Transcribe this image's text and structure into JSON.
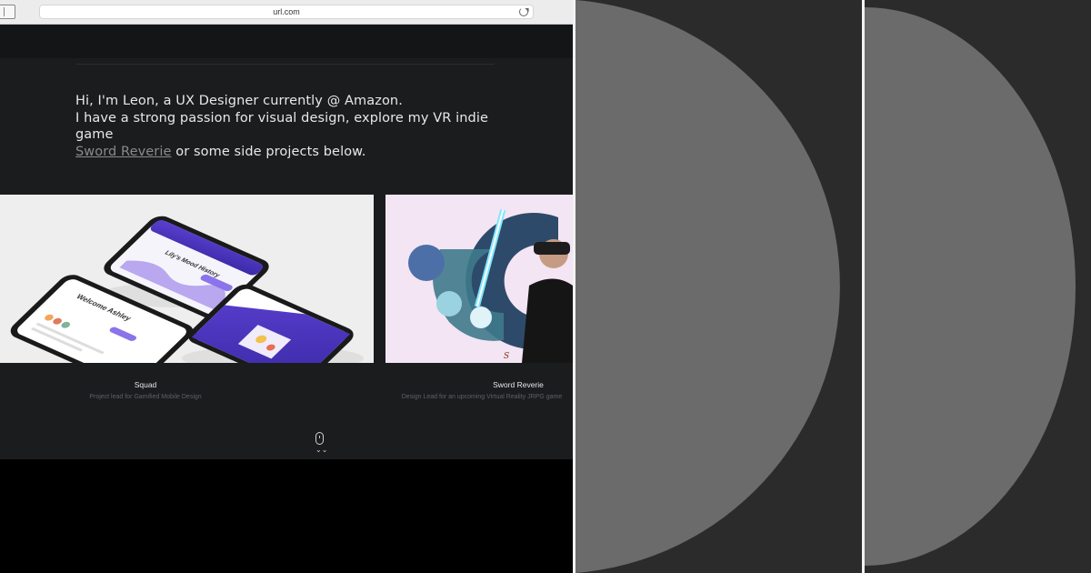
{
  "browser": {
    "url": "url.com"
  },
  "intro": {
    "line1": "Hi, I'm Leon, a UX Designer currently @ Amazon.",
    "line2": "I have a strong passion for visual design, explore my VR indie game",
    "link_text": "Sword Reverie",
    "line3_rest": " or some side projects below."
  },
  "projects": [
    {
      "title": "Squad",
      "subtitle": "Project lead for Gamified Mobile Design",
      "screens": [
        "Lily's Mood History",
        "Welcome Ashley"
      ]
    },
    {
      "title": "Sword Reverie",
      "subtitle": "Design Lead for an upcoming Virtual Reality JRPG game"
    }
  ],
  "icons": {
    "sidebar": "sidebar-toggle-icon",
    "reload": "reload-icon",
    "scroll": "mouse-scroll-icon",
    "chevron": "double-chevron-down-icon",
    "chevron_glyph": "⌄⌄"
  },
  "colors": {
    "page_bg": "#1b1c1e",
    "panel_bg": "#2b2b2b",
    "semicircle": "#6b6b6b"
  }
}
